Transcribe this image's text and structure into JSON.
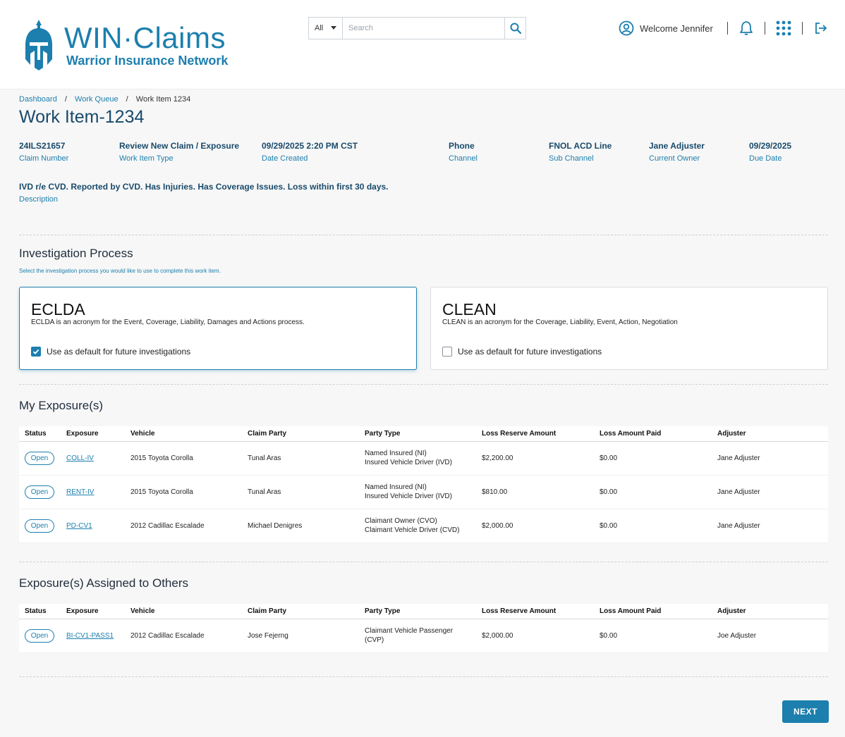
{
  "brand": {
    "title": "WIN·Claims",
    "subtitle": "Warrior Insurance Network",
    "color": "#1c7fae"
  },
  "header": {
    "search": {
      "scope": "All",
      "placeholder": "Search"
    },
    "welcome": "Welcome Jennifer",
    "icons": [
      "user-circle-icon",
      "bell-icon",
      "apps-grid-icon",
      "logout-icon"
    ]
  },
  "breadcrumb": [
    "Dashboard",
    "Work Queue",
    "Work Item 1234"
  ],
  "page_title": "Work Item-1234",
  "meta": [
    {
      "value": "24ILS21657",
      "label": "Claim Number"
    },
    {
      "value": "Review New Claim / Exposure",
      "label": "Work Item Type"
    },
    {
      "value": "09/29/2025 2:20 PM CST",
      "label": "Date Created"
    },
    {
      "value": "Phone",
      "label": "Channel"
    },
    {
      "value": "FNOL ACD Line",
      "label": "Sub Channel"
    },
    {
      "value": "Jane Adjuster",
      "label": "Current Owner"
    },
    {
      "value": "09/29/2025",
      "label": "Due Date"
    }
  ],
  "description": {
    "value": "IVD r/e CVD.  Reported by CVD. Has Injuries.  Has Coverage Issues.  Loss within first 30 days.",
    "label": "Description"
  },
  "investigation": {
    "title": "Investigation Process",
    "hint": "Select the investigation process you would like to use to complete this work item.",
    "options": [
      {
        "title": "ECLDA",
        "desc": "ECLDA is an acronym for the Event, Coverage, Liability, Damages and Actions process.",
        "check_label": "Use as default for future investigations",
        "checked": true,
        "selected": true
      },
      {
        "title": "CLEAN",
        "desc": "CLEAN is an acronym for the Coverage, Liability, Event, Action, Negotiation",
        "check_label": "Use as default for future investigations",
        "checked": false,
        "selected": false
      }
    ]
  },
  "columns": [
    "Status",
    "Exposure",
    "Vehicle",
    "Claim Party",
    "Party Type",
    "Loss Reserve Amount",
    "Loss Amount Paid",
    "Adjuster"
  ],
  "my_exposures": {
    "title": "My Exposure(s)",
    "rows": [
      {
        "status": "Open",
        "exposure": "COLL-IV",
        "vehicle": "2015 Toyota Corolla",
        "party": "Tunal Aras",
        "party_type": [
          "Named Insured (NI)",
          "Insured Vehicle Driver (IVD)"
        ],
        "reserve": "$2,200.00",
        "paid": "$0.00",
        "adjuster": "Jane Adjuster"
      },
      {
        "status": "Open",
        "exposure": "RENT-IV",
        "vehicle": "2015 Toyota Corolla",
        "party": "Tunal Aras",
        "party_type": [
          "Named Insured (NI)",
          "Insured Vehicle Driver (IVD)"
        ],
        "reserve": "$810.00",
        "paid": "$0.00",
        "adjuster": "Jane Adjuster"
      },
      {
        "status": "Open",
        "exposure": "PD-CV1",
        "vehicle": "2012 Cadillac Escalade",
        "party": "Michael Denigres",
        "party_type": [
          "Claimant Owner (CVO)",
          "Claimant Vehicle Driver (CVD)"
        ],
        "reserve": "$2,000.00",
        "paid": "$0.00",
        "adjuster": "Jane Adjuster"
      }
    ]
  },
  "other_exposures": {
    "title": "Exposure(s) Assigned to Others",
    "rows": [
      {
        "status": "Open",
        "exposure": "BI-CV1-PASS1",
        "vehicle": "2012 Cadillac Escalade",
        "party": "Jose Fejerng",
        "party_type": [
          "Claimant Vehicle Passenger",
          "(CVP)"
        ],
        "reserve": "$2,000.00",
        "paid": "$0.00",
        "adjuster": "Joe Adjuster"
      }
    ]
  },
  "next_label": "NEXT"
}
